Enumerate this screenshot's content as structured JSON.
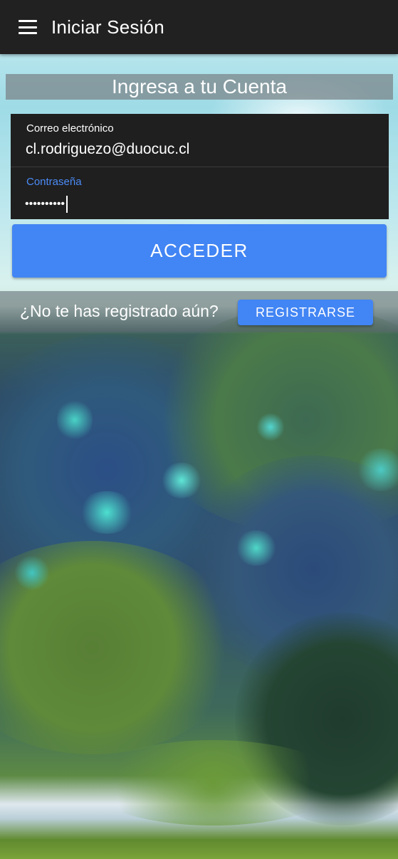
{
  "app_bar": {
    "menu_icon": "hamburger-menu-icon",
    "title": "Iniciar Sesión"
  },
  "login": {
    "heading": "Ingresa a tu Cuenta",
    "email": {
      "label": "Correo electrónico",
      "value": "cl.rodriguezo@duocuc.cl"
    },
    "password": {
      "label": "Contraseña",
      "value": "••••••••••",
      "focused": true
    },
    "submit_label": "ACCEDER"
  },
  "register": {
    "question": "¿No te has registrado aún?",
    "button_label": "REGISTRARSE"
  },
  "colors": {
    "app_bar": "#212121",
    "primary": "#4285f4",
    "field_background": "#1f1f1f",
    "focused_label": "#4b8cf7"
  }
}
